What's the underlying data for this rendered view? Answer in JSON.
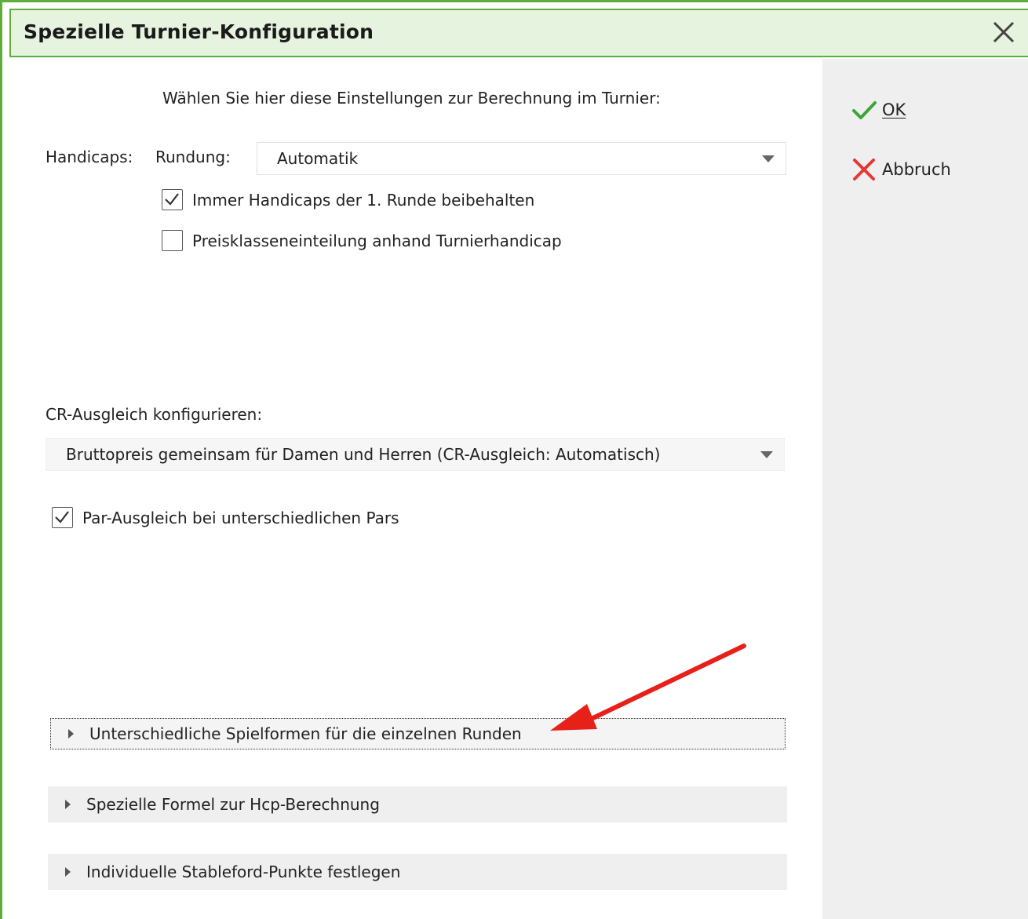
{
  "dialog": {
    "title": "Spezielle Turnier-Konfiguration",
    "close_icon": "close-icon"
  },
  "actions": {
    "ok_label": "OK",
    "cancel_label": "Abbruch"
  },
  "intro": "Wählen Sie hier diese Einstellungen zur Berechnung im Turnier:",
  "handicaps": {
    "label": "Handicaps:",
    "rounding_label": "Rundung:",
    "rounding_value": "Automatik",
    "keep_first_round": {
      "label": "Immer Handicaps der 1. Runde beibehalten",
      "checked": true
    },
    "price_class": {
      "label": "Preisklasseneinteilung anhand Turnierhandicap",
      "checked": false
    }
  },
  "cr": {
    "label": "CR-Ausgleich konfigurieren:",
    "value": "Bruttopreis gemeinsam für Damen und Herren (CR-Ausgleich: Automatisch)",
    "par_balance": {
      "label": "Par-Ausgleich bei unterschiedlichen Pars",
      "checked": true
    }
  },
  "expanders": [
    {
      "label": "Unterschiedliche Spielformen für die einzelnen Runden"
    },
    {
      "label": "Spezielle Formel zur Hcp-Berechnung"
    },
    {
      "label": "Individuelle Stableford-Punkte festlegen"
    }
  ],
  "colors": {
    "accent": "#5fae3b",
    "ok": "#3aa635",
    "cancel": "#e53935",
    "annotation": "#e8201a"
  }
}
